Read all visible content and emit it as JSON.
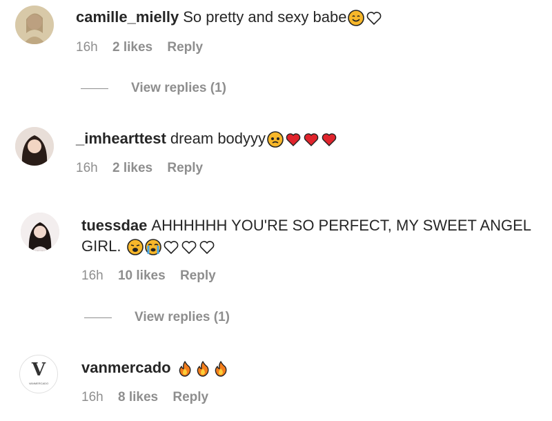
{
  "comments": [
    {
      "username": "camille_mielly",
      "text": "So pretty and sexy babe",
      "emojis": [
        "smiling-face-emoji",
        "outline-heart-icon"
      ],
      "time": "16h",
      "likes": "2 likes",
      "reply_label": "Reply",
      "view_replies": "View replies (1)"
    },
    {
      "username": "_imhearttest",
      "text": "dream bodyyy",
      "emojis": [
        "pleading-face-emoji",
        "red-heart-emoji",
        "red-heart-emoji",
        "red-heart-emoji"
      ],
      "time": "16h",
      "likes": "2 likes",
      "reply_label": "Reply"
    },
    {
      "username": "tuessdae",
      "text": "AHHHHHH YOU'RE SO PERFECT, MY SWEET ANGEL GIRL.",
      "emojis": [
        "weary-face-emoji",
        "crying-face-emoji",
        "outline-heart-icon",
        "outline-heart-icon",
        "outline-heart-icon"
      ],
      "time": "16h",
      "likes": "10 likes",
      "reply_label": "Reply",
      "view_replies": "View replies (1)"
    },
    {
      "username": "vanmercado",
      "text": "",
      "emojis": [
        "fire-emoji",
        "fire-emoji",
        "fire-emoji"
      ],
      "time": "16h",
      "likes": "8 likes",
      "reply_label": "Reply",
      "avatar_logo": "V",
      "avatar_logo_sub": "VANMERCADO"
    }
  ],
  "colors": {
    "text": "#262626",
    "meta": "#8e8e8e",
    "heart_red": "#e0242c",
    "emoji_yellow": "#f7b72a"
  }
}
